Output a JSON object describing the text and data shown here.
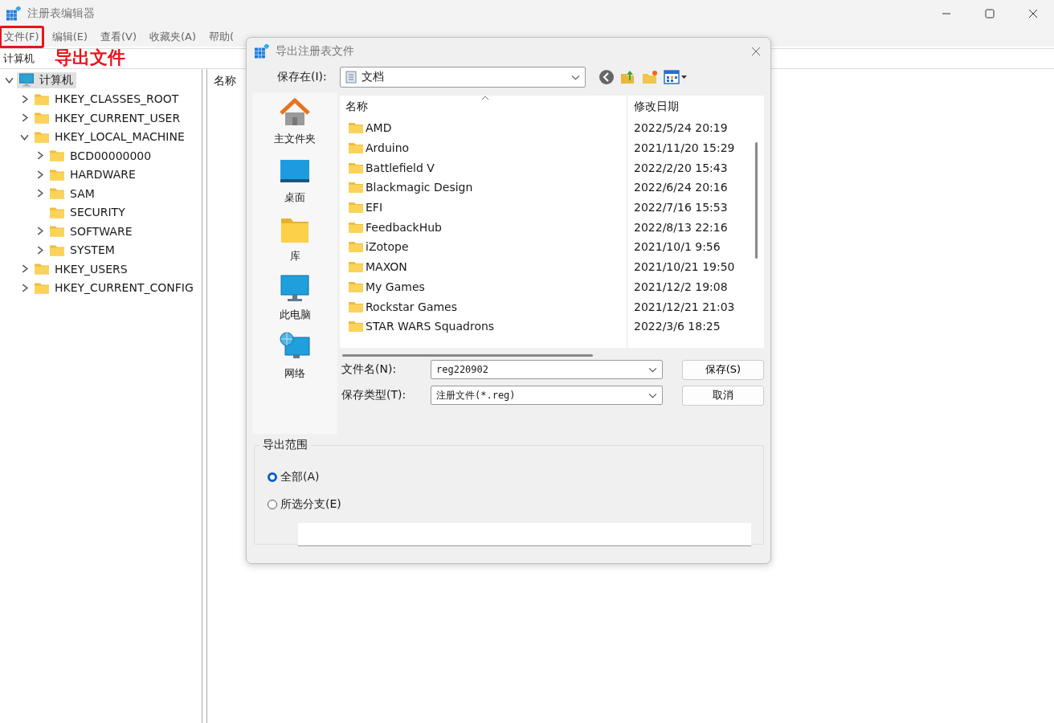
{
  "window": {
    "title": "注册表编辑器"
  },
  "menu": [
    {
      "label": "文件(F)",
      "highlighted": true
    },
    {
      "label": "编辑(E)",
      "highlighted": false
    },
    {
      "label": "查看(V)",
      "highlighted": false
    },
    {
      "label": "收藏夹(A)",
      "highlighted": false
    },
    {
      "label": "帮助(",
      "highlighted": false
    }
  ],
  "annotation": "导出文件",
  "address_bar": "计算机",
  "tree": {
    "label": "计算机",
    "kind": "computer",
    "selected": true,
    "expanded": true,
    "children": [
      {
        "label": "HKEY_CLASSES_ROOT",
        "kind": "folder",
        "selected": false,
        "expanded": false,
        "has_children": true
      },
      {
        "label": "HKEY_CURRENT_USER",
        "kind": "folder",
        "selected": false,
        "expanded": false,
        "has_children": true
      },
      {
        "label": "HKEY_LOCAL_MACHINE",
        "kind": "folder",
        "selected": false,
        "expanded": true,
        "has_children": true,
        "children": [
          {
            "label": "BCD00000000",
            "kind": "folder",
            "selected": false,
            "expanded": false,
            "has_children": true
          },
          {
            "label": "HARDWARE",
            "kind": "folder",
            "selected": false,
            "expanded": false,
            "has_children": true
          },
          {
            "label": "SAM",
            "kind": "folder",
            "selected": false,
            "expanded": false,
            "has_children": true
          },
          {
            "label": "SECURITY",
            "kind": "folder",
            "selected": false,
            "expanded": false,
            "has_children": false
          },
          {
            "label": "SOFTWARE",
            "kind": "folder",
            "selected": false,
            "expanded": false,
            "has_children": true
          },
          {
            "label": "SYSTEM",
            "kind": "folder",
            "selected": false,
            "expanded": false,
            "has_children": true
          }
        ]
      },
      {
        "label": "HKEY_USERS",
        "kind": "folder",
        "selected": false,
        "expanded": false,
        "has_children": true
      },
      {
        "label": "HKEY_CURRENT_CONFIG",
        "kind": "folder",
        "selected": false,
        "expanded": false,
        "has_children": true
      }
    ]
  },
  "list_header": "名称",
  "dialog": {
    "title": "导出注册表文件",
    "save_in_label": "保存在(I):",
    "location": "文档",
    "places": [
      {
        "label": "主文件夹",
        "kind": "home"
      },
      {
        "label": "桌面",
        "kind": "desktop"
      },
      {
        "label": "库",
        "kind": "library"
      },
      {
        "label": "此电脑",
        "kind": "pc"
      },
      {
        "label": "网络",
        "kind": "network"
      }
    ],
    "columns": [
      "名称",
      "修改日期"
    ],
    "files": [
      {
        "name": "AMD",
        "date": "2022/5/24 20:19"
      },
      {
        "name": "Arduino",
        "date": "2021/11/20 15:29"
      },
      {
        "name": "Battlefield V",
        "date": "2022/2/20 15:43"
      },
      {
        "name": "Blackmagic Design",
        "date": "2022/6/24 20:16"
      },
      {
        "name": "EFI",
        "date": "2022/7/16 15:53"
      },
      {
        "name": "FeedbackHub",
        "date": "2022/8/13 22:16"
      },
      {
        "name": "iZotope",
        "date": "2021/10/1 9:56"
      },
      {
        "name": "MAXON",
        "date": "2021/10/21 19:50"
      },
      {
        "name": "My Games",
        "date": "2021/12/2 19:08"
      },
      {
        "name": "Rockstar Games",
        "date": "2021/12/21 21:03"
      },
      {
        "name": "STAR WARS Squadrons",
        "date": "2022/3/6 18:25"
      }
    ],
    "filename_label": "文件名(N):",
    "filename": "reg220902",
    "type_label": "保存类型(T):",
    "type": "注册文件(*.reg)",
    "buttons": [
      "保存(S)",
      "取消"
    ],
    "export_range": {
      "title": "导出范围",
      "options": [
        {
          "label": "全部(A)",
          "selected": true
        },
        {
          "label": "所选分支(E)",
          "selected": false
        }
      ]
    }
  }
}
